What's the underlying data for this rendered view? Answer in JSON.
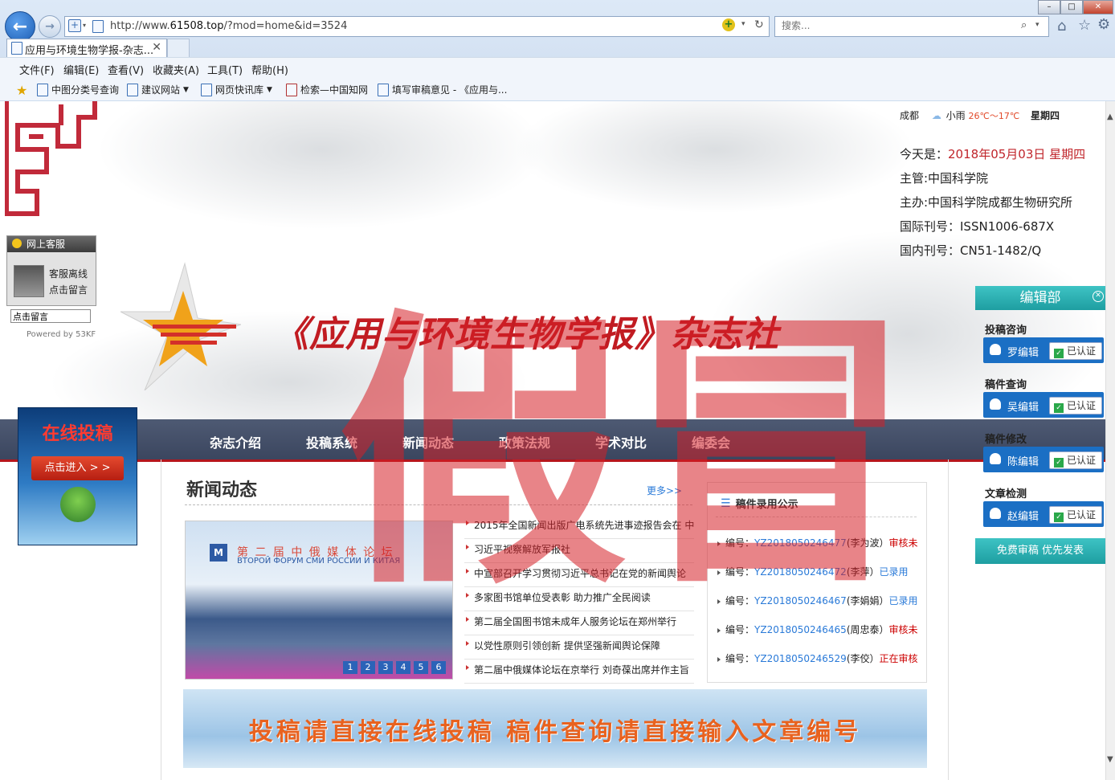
{
  "browser": {
    "url_prefix": "http://www.",
    "url_domain": "61508.top",
    "url_suffix": "/?mod=home&id=3524",
    "search_placeholder": "搜索...",
    "tab_title": "应用与环境生物学报-杂志...",
    "menu": [
      "文件(F)",
      "编辑(E)",
      "查看(V)",
      "收藏夹(A)",
      "工具(T)",
      "帮助(H)"
    ],
    "favorites": [
      "中图分类号查询",
      "建议网站",
      "网页快讯库",
      "检索—中国知网",
      "填写审稿意见 - 《应用与..."
    ]
  },
  "header": {
    "weather_city": "成都",
    "weather_cond": "小雨",
    "weather_temp": "26℃～17℃",
    "weather_day": "星期四",
    "today_label": "今天是：",
    "today_value": "2018年05月03日 星期四",
    "host": "主管:中国科学院",
    "sponsor": "主办:中国科学院成都生物研究所",
    "issn": "国际刊号：ISSN1006-687X",
    "cn": "国内刊号：CN51-1482/Q",
    "site_title": "《应用与环境生物学报》杂志社"
  },
  "kf": {
    "title": "网上客服",
    "status": "客服离线",
    "leave_msg": "点击留言",
    "input_value": "点击留言",
    "powered": "Powered by 53KF"
  },
  "nav": [
    "杂志介绍",
    "投稿系统",
    "新闻动态",
    "政策法规",
    "学术对比",
    "编委会"
  ],
  "tougao": {
    "title": "在线投稿",
    "enter": "点击进入 > >"
  },
  "news": {
    "title": "新闻动态",
    "more": "更多>>",
    "photo_title": "第 二 届 中 俄 媒 体 论 坛",
    "photo_subtitle": "ВТОРОЙ ФОРУМ СМИ РОССИИ И КИТАЯ",
    "pages": [
      "1",
      "2",
      "3",
      "4",
      "5",
      "6"
    ],
    "items": [
      "2015年全国新闻出版广电系统先进事迹报告会在 中",
      "习近平视察解放军报社",
      "中宣部召开学习贯彻习近平总书记在党的新闻舆论",
      "多家图书馆单位受表彰 助力推广全民阅读",
      "第二届全国图书馆未成年人服务论坛在郑州举行",
      "以党性原则引领创新 提供坚强新闻舆论保障",
      "第二届中俄媒体论坛在京举行 刘奇葆出席并作主旨"
    ]
  },
  "records": {
    "title": "稿件录用公示",
    "prefix": "编号：",
    "items": [
      {
        "id": "YZ2018050246477",
        "name": "(李为波）",
        "status": "审核未"
      },
      {
        "id": "YZ2018050246472",
        "name": "(李萍）",
        "status": "已录用"
      },
      {
        "id": "YZ2018050246467",
        "name": "(李娟娟）",
        "status": "已录用"
      },
      {
        "id": "YZ2018050246465",
        "name": "(周忠泰）",
        "status": "审核未"
      },
      {
        "id": "YZ2018050246529",
        "name": "(李佼）",
        "status": "正在审核"
      }
    ]
  },
  "banner": {
    "text": "投稿请直接在线投稿  稿件查询请直接输入文章编号"
  },
  "editor": {
    "title": "编辑部",
    "verified": "已认证",
    "sections": [
      {
        "label": "投稿咨询",
        "name": "罗编辑"
      },
      {
        "label": "稿件查询",
        "name": "吴编辑"
      },
      {
        "label": "稿件修改",
        "name": "陈编辑"
      },
      {
        "label": "文章检测",
        "name": "赵编辑"
      }
    ],
    "free_review": "免费审稿 优先发表"
  },
  "overlay": {
    "text": "假冒"
  },
  "colors": {
    "brand_red": "#c11c22",
    "nav_bg": "#4a5670",
    "link_blue": "#2a7ad8",
    "teal": "#25aeb0"
  }
}
